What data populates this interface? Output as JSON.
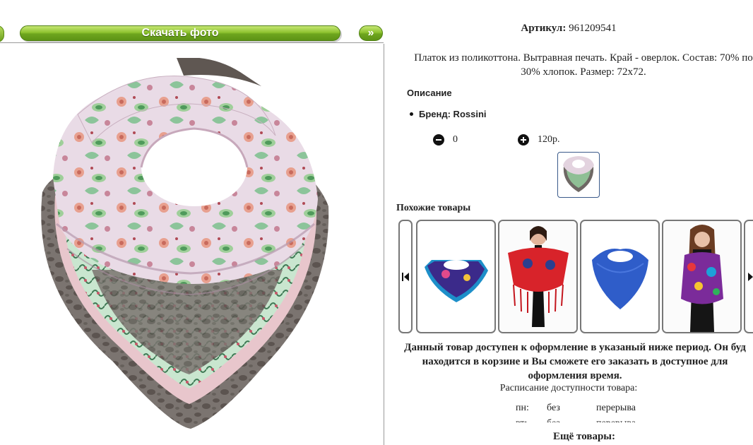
{
  "toolbar": {
    "download_label": "Скачать фото",
    "next_label": "»"
  },
  "product": {
    "sku_label": "Артикул:",
    "sku_value": "961209541",
    "description_line1": "Платок из поликоттона. Вытравная печать. Край - оверлок. Состав: 70% по",
    "description_line2": "30% хлопок. Размер: 72x72.",
    "section_title": "Описание",
    "brand": "Бренд: Rossini",
    "quantity": "0",
    "price": "120р."
  },
  "similar": {
    "title": "Похожие товары",
    "items": [
      "scarf-blue-purple",
      "model-red-shawl",
      "scarf-blue",
      "model-colorful-scarf"
    ]
  },
  "availability": {
    "notice_line1": "Данный товар доступен к оформление в указаный ниже период. Он буд",
    "notice_line2": "находится в корзине и Вы сможете его заказать в доступное для",
    "notice_line3": "оформления время.",
    "schedule_title": "Расписание доступности товара:",
    "rows": [
      {
        "day": "пн:",
        "from": "без",
        "to": "перерыва"
      },
      {
        "day": "вт:",
        "from": "без",
        "to": "перерыва"
      }
    ]
  },
  "more_title": "Ещё товары:",
  "colors": {
    "green_button": "#7ab326",
    "border_gray": "#777777",
    "thumb_border": "#3a5a8a"
  }
}
